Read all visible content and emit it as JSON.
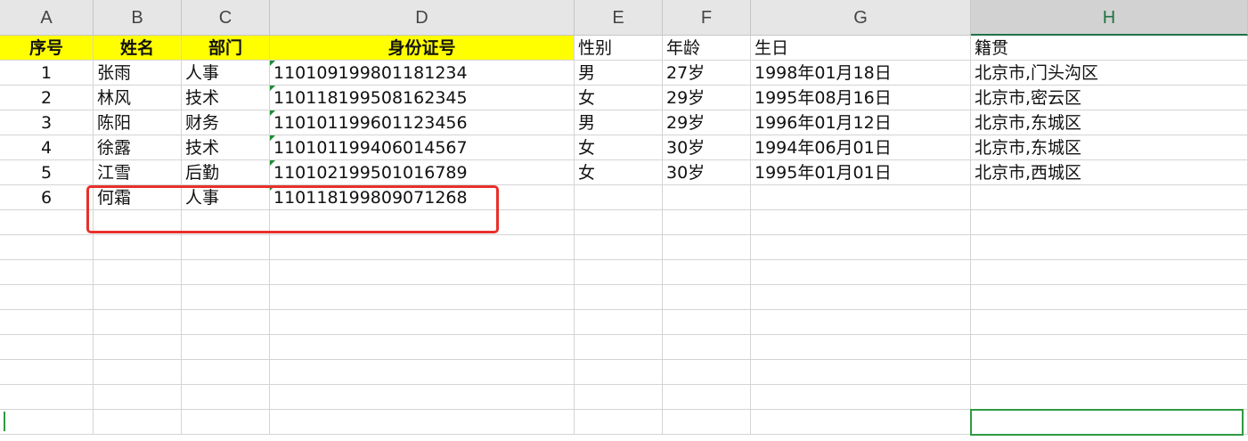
{
  "columns": [
    "A",
    "B",
    "C",
    "D",
    "E",
    "F",
    "G",
    "H"
  ],
  "selected_column": "H",
  "header_row": [
    "序号",
    "姓名",
    "部门",
    "身份证号",
    "性别",
    "年龄",
    "生日",
    "籍贯"
  ],
  "rows": [
    [
      "1",
      "张雨",
      "人事",
      "110109199801181234",
      "男",
      "27岁",
      "1998年01月18日",
      "北京市,门头沟区"
    ],
    [
      "2",
      "林风",
      "技术",
      "110118199508162345",
      "女",
      "29岁",
      "1995年08月16日",
      "北京市,密云区"
    ],
    [
      "3",
      "陈阳",
      "财务",
      "110101199601123456",
      "男",
      "29岁",
      "1996年01月12日",
      "北京市,东城区"
    ],
    [
      "4",
      "徐露",
      "技术",
      "110101199406014567",
      "女",
      "30岁",
      "1994年06月01日",
      "北京市,东城区"
    ],
    [
      "5",
      "江雪",
      "后勤",
      "110102199501016789",
      "女",
      "30岁",
      "1995年01月01日",
      "北京市,西城区"
    ],
    [
      "6",
      "何霜",
      "人事",
      "110118199809071268",
      "",
      "",
      "",
      ""
    ]
  ],
  "colors": {
    "header_highlight": "#ffff00",
    "annotation": "#e8302a",
    "selection": "#2e9a43"
  }
}
